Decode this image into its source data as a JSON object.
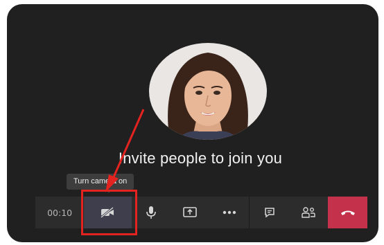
{
  "stage": {
    "invite_text": "Invite people to join you"
  },
  "tooltip": {
    "text": "Turn camera on"
  },
  "toolbar": {
    "timer": "00:10",
    "buttons": [
      {
        "icon": "camera-off-icon"
      },
      {
        "icon": "microphone-icon"
      },
      {
        "icon": "share-screen-icon"
      },
      {
        "icon": "more-options-icon"
      },
      {
        "icon": "chat-icon"
      },
      {
        "icon": "participants-icon"
      },
      {
        "icon": "hang-up-icon"
      }
    ]
  },
  "colors": {
    "background": "#202020",
    "toolbar": "#2c2c2c",
    "hangup": "#c4314b",
    "annotation": "#e3231f"
  }
}
